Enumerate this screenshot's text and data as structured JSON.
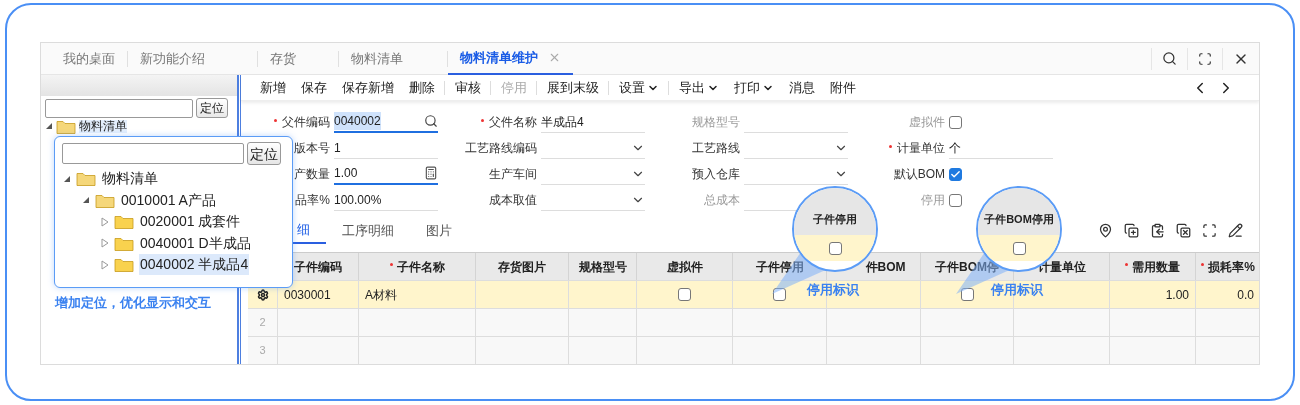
{
  "tabs": [
    {
      "label": "我的桌面",
      "selected": false
    },
    {
      "label": "新功能介绍",
      "selected": false
    },
    {
      "label": "存货",
      "selected": false
    },
    {
      "label": "物料清单",
      "selected": false
    },
    {
      "label": "物料清单维护",
      "selected": true
    }
  ],
  "left_panel": {
    "locate_button": "定位",
    "tree_root": "物料清单",
    "caption": "增加定位，优化显示和交互"
  },
  "popup": {
    "locate_button": "定位",
    "tree": [
      {
        "label": "物料清单",
        "expanded": true,
        "selected": false,
        "children": [
          {
            "label": "0010001 A产品",
            "expanded": true,
            "selected": false,
            "children": [
              {
                "label": "0020001 成套件",
                "expanded": false,
                "selected": false
              },
              {
                "label": "0040001 D半成品",
                "expanded": false,
                "selected": false
              },
              {
                "label": "0040002 半成品4",
                "expanded": false,
                "selected": true
              }
            ]
          }
        ]
      }
    ]
  },
  "toolbar": {
    "groups": [
      [
        {
          "label": "新增",
          "disabled": false,
          "dropdown": false
        },
        {
          "label": "保存",
          "disabled": false,
          "dropdown": false
        },
        {
          "label": "保存新增",
          "disabled": false,
          "dropdown": false
        },
        {
          "label": "删除",
          "disabled": false,
          "dropdown": false
        }
      ],
      [
        {
          "label": "审核",
          "disabled": false,
          "dropdown": false
        }
      ],
      [
        {
          "label": "停用",
          "disabled": true,
          "dropdown": false
        }
      ],
      [
        {
          "label": "展到末级",
          "disabled": false,
          "dropdown": false
        }
      ],
      [
        {
          "label": "设置",
          "disabled": false,
          "dropdown": true
        }
      ],
      [
        {
          "label": "导出",
          "disabled": false,
          "dropdown": true
        },
        {
          "label": "打印",
          "disabled": false,
          "dropdown": true
        },
        {
          "label": "消息",
          "disabled": false,
          "dropdown": false
        },
        {
          "label": "附件",
          "disabled": false,
          "dropdown": false
        }
      ]
    ]
  },
  "form": {
    "fields": [
      {
        "label": "父件编码",
        "required": true,
        "kind": "search",
        "value": "0040002",
        "focused": true,
        "disabled": false
      },
      {
        "label": "父件名称",
        "required": true,
        "kind": "text",
        "value": "半成品4",
        "focused": false,
        "disabled": false
      },
      {
        "label": "规格型号",
        "required": false,
        "kind": "text",
        "focused": false,
        "disabled": true
      },
      {
        "label": "虚拟件",
        "required": false,
        "kind": "checkbox",
        "checked": false,
        "disabled": true
      },
      {
        "label": "版本号",
        "required": false,
        "kind": "text",
        "value": "1",
        "focused": false,
        "disabled": false
      },
      {
        "label": "工艺路线编码",
        "required": false,
        "kind": "dropdown",
        "focused": false,
        "disabled": false
      },
      {
        "label": "工艺路线",
        "required": false,
        "kind": "dropdown",
        "focused": false,
        "disabled": false
      },
      {
        "label": "计量单位",
        "required": true,
        "kind": "text",
        "value": "个",
        "focused": false,
        "disabled": false
      },
      {
        "label": "产数量",
        "required": false,
        "kind": "number",
        "value": "1.00",
        "focused": true,
        "disabled": false
      },
      {
        "label": "生产车间",
        "required": false,
        "kind": "dropdown",
        "focused": false,
        "disabled": false
      },
      {
        "label": "预入仓库",
        "required": false,
        "kind": "dropdown",
        "focused": false,
        "disabled": false
      },
      {
        "label": "默认BOM",
        "required": false,
        "kind": "checkbox",
        "checked": true,
        "disabled": false
      },
      {
        "label": "品率%",
        "required": false,
        "kind": "text",
        "value": "100.00%",
        "focused": false,
        "disabled": false
      },
      {
        "label": "成本取值",
        "required": false,
        "kind": "dropdown",
        "focused": false,
        "disabled": false
      },
      {
        "label": "总成本",
        "required": false,
        "kind": "text",
        "focused": false,
        "disabled": true
      },
      {
        "label": "停用",
        "required": false,
        "kind": "checkbox",
        "checked": false,
        "disabled": true
      }
    ]
  },
  "detail_tabs": [
    {
      "label": "细",
      "selected": true
    },
    {
      "label": "工序明细",
      "selected": false
    },
    {
      "label": "图片",
      "selected": false
    }
  ],
  "table": {
    "columns": [
      {
        "label": "子件编码",
        "required": false
      },
      {
        "label": "子件名称",
        "required": true
      },
      {
        "label": "存货图片",
        "required": false
      },
      {
        "label": "规格型号",
        "required": false
      },
      {
        "label": "虚拟件",
        "required": false
      },
      {
        "label": "子件停用",
        "required": false
      },
      {
        "label": "件BOM",
        "required": false
      },
      {
        "label": "子件BOM停",
        "required": false
      },
      {
        "label": "计量单位",
        "required": false
      },
      {
        "label": "需用数量",
        "required": true
      },
      {
        "label": "损耗率%",
        "required": true
      }
    ],
    "rows": [
      {
        "kind": "current",
        "selected": true,
        "cells": [
          {
            "kind": "text",
            "text": "0030001"
          },
          {
            "kind": "text",
            "text": "A材料"
          },
          {
            "kind": "empty"
          },
          {
            "kind": "empty"
          },
          {
            "kind": "checkbox",
            "checked": false
          },
          {
            "kind": "checkbox",
            "checked": false
          },
          {
            "kind": "empty"
          },
          {
            "kind": "checkbox",
            "checked": false
          },
          {
            "kind": "empty"
          },
          {
            "kind": "number",
            "text": "1.00"
          },
          {
            "kind": "number",
            "text": "0.0"
          }
        ]
      },
      {
        "kind": "numbered",
        "number": "2",
        "selected": false
      },
      {
        "kind": "numbered",
        "number": "3",
        "selected": false
      }
    ]
  },
  "callouts": [
    {
      "header": "子件停用",
      "checked": false,
      "label": "停用标识"
    },
    {
      "header": "子件BOM停用",
      "checked": false,
      "label": "停用标识"
    }
  ]
}
